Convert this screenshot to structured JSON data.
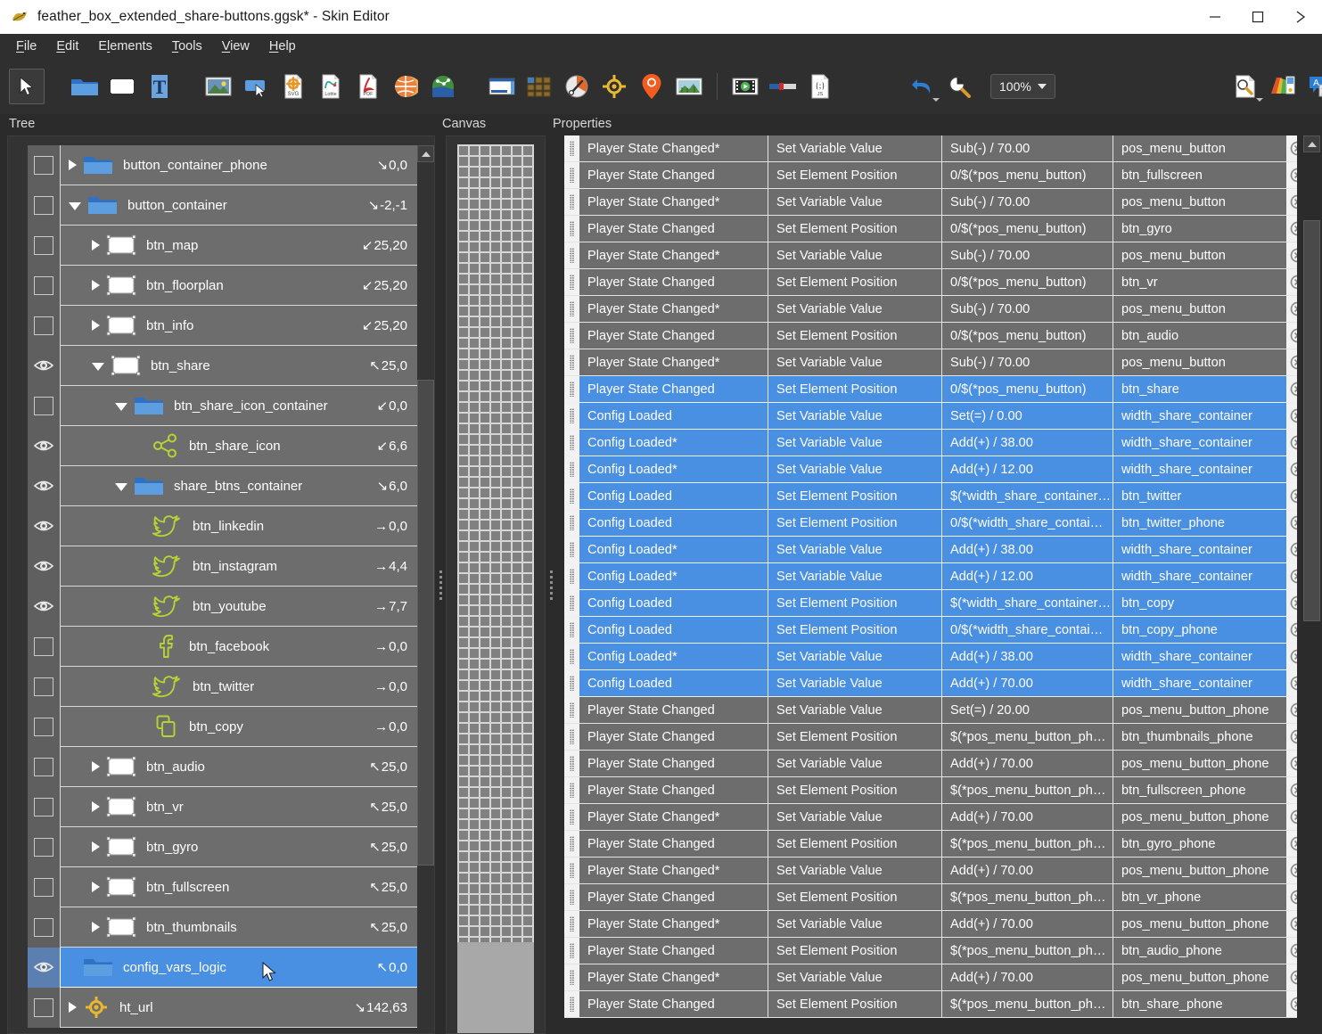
{
  "window": {
    "title": "feather_box_extended_share-buttons.ggsk* - Skin Editor",
    "app_icon": "app-logo-icon",
    "minimize_label": "—",
    "maximize_label": "□",
    "close_label": "✕"
  },
  "menubar": {
    "items": [
      {
        "label": "File",
        "mnemonic": "F"
      },
      {
        "label": "Edit",
        "mnemonic": "E"
      },
      {
        "label": "Elements",
        "mnemonic": "E"
      },
      {
        "label": "Tools",
        "mnemonic": "T"
      },
      {
        "label": "View",
        "mnemonic": "V"
      },
      {
        "label": "Help",
        "mnemonic": "H"
      }
    ]
  },
  "toolbar": {
    "zoom_value": "100%",
    "items": [
      {
        "name": "select-tool-icon",
        "title": "Select"
      },
      {
        "name": "add-container-icon",
        "title": "Container"
      },
      {
        "name": "add-rectangle-icon",
        "title": "Rectangle"
      },
      {
        "name": "add-text-icon",
        "title": "Text"
      },
      {
        "name": "add-image-icon",
        "title": "Image"
      },
      {
        "name": "add-button-icon",
        "title": "Button"
      },
      {
        "name": "add-svg-icon",
        "title": "SVG"
      },
      {
        "name": "add-lottie-icon",
        "title": "Lottie"
      },
      {
        "name": "add-pdf-icon",
        "title": "PDF"
      },
      {
        "name": "add-globe-icon",
        "title": "Globe"
      },
      {
        "name": "add-map-icon",
        "title": "Map"
      },
      {
        "name": "add-iframe-icon",
        "title": "IFrame"
      },
      {
        "name": "add-thumbnails-icon",
        "title": "Thumbnails"
      },
      {
        "name": "add-compass-icon",
        "title": "Compass"
      },
      {
        "name": "add-target-icon",
        "title": "Target"
      },
      {
        "name": "add-mappin-icon",
        "title": "Map pin"
      },
      {
        "name": "add-panorama-icon",
        "title": "Panorama"
      },
      {
        "name": "add-video-icon",
        "title": "Video"
      },
      {
        "name": "add-progressbar-icon",
        "title": "Progress bar"
      },
      {
        "name": "add-javascript-icon",
        "title": "JavaScript"
      },
      {
        "name": "undo-icon",
        "title": "Undo"
      },
      {
        "name": "zoom-tool-icon",
        "title": "Zoom"
      },
      {
        "name": "inspect-document-icon",
        "title": "Inspect"
      },
      {
        "name": "palette-icon",
        "title": "Color palette"
      },
      {
        "name": "translate-icon",
        "title": "Translate"
      },
      {
        "name": "statistics-icon",
        "title": "Statistics"
      }
    ]
  },
  "panels": {
    "tree_header": "Tree",
    "canvas_header": "Canvas",
    "properties_header": "Properties"
  },
  "tree": {
    "rows": [
      {
        "label": "button_container_phone",
        "icon": "folder-icon",
        "indent": 0,
        "twisty": "closed",
        "vis": "checkbox",
        "arrow": "↘",
        "coord": "0,0",
        "selected": false
      },
      {
        "label": "button_container",
        "icon": "folder-icon",
        "indent": 0,
        "twisty": "open",
        "vis": "checkbox",
        "arrow": "↘",
        "coord": "-2,-1",
        "selected": false
      },
      {
        "label": "btn_map",
        "icon": "rect-icon",
        "indent": 1,
        "twisty": "closed",
        "vis": "checkbox",
        "arrow": "↙",
        "coord": "25,20",
        "selected": false
      },
      {
        "label": "btn_floorplan",
        "icon": "rect-icon",
        "indent": 1,
        "twisty": "closed",
        "vis": "checkbox",
        "arrow": "↙",
        "coord": "25,20",
        "selected": false
      },
      {
        "label": "btn_info",
        "icon": "rect-icon",
        "indent": 1,
        "twisty": "closed",
        "vis": "checkbox",
        "arrow": "↙",
        "coord": "25,20",
        "selected": false
      },
      {
        "label": "btn_share",
        "icon": "rect-icon",
        "indent": 1,
        "twisty": "open",
        "vis": "eye",
        "arrow": "↖",
        "coord": "25,0",
        "selected": false
      },
      {
        "label": "btn_share_icon_container",
        "icon": "folder-icon",
        "indent": 2,
        "twisty": "open",
        "vis": "checkbox",
        "arrow": "↙",
        "coord": "0,0",
        "selected": false
      },
      {
        "label": "btn_share_icon",
        "icon": "share-icon",
        "indent": 3,
        "twisty": "none",
        "vis": "eye",
        "arrow": "↙",
        "coord": "6,6",
        "selected": false
      },
      {
        "label": "share_btns_container",
        "icon": "folder-icon",
        "indent": 2,
        "twisty": "open",
        "vis": "eye",
        "arrow": "↘",
        "coord": "6,0",
        "selected": false
      },
      {
        "label": "btn_linkedin",
        "icon": "twitter-icon",
        "indent": 3,
        "twisty": "none",
        "vis": "eye",
        "arrow": "→",
        "coord": "0,0",
        "selected": false
      },
      {
        "label": "btn_instagram",
        "icon": "twitter-icon",
        "indent": 3,
        "twisty": "none",
        "vis": "eye",
        "arrow": "→",
        "coord": "4,4",
        "selected": false
      },
      {
        "label": "btn_youtube",
        "icon": "twitter-icon",
        "indent": 3,
        "twisty": "none",
        "vis": "eye",
        "arrow": "→",
        "coord": "7,7",
        "selected": false
      },
      {
        "label": "btn_facebook",
        "icon": "facebook-icon",
        "indent": 3,
        "twisty": "none",
        "vis": "checkbox",
        "arrow": "→",
        "coord": "0,0",
        "selected": false
      },
      {
        "label": "btn_twitter",
        "icon": "twitter-icon",
        "indent": 3,
        "twisty": "none",
        "vis": "checkbox",
        "arrow": "→",
        "coord": "0,0",
        "selected": false
      },
      {
        "label": "btn_copy",
        "icon": "copy-icon",
        "indent": 3,
        "twisty": "none",
        "vis": "checkbox",
        "arrow": "→",
        "coord": "0,0",
        "selected": false
      },
      {
        "label": "btn_audio",
        "icon": "rect-icon",
        "indent": 1,
        "twisty": "closed",
        "vis": "checkbox",
        "arrow": "↖",
        "coord": "25,0",
        "selected": false
      },
      {
        "label": "btn_vr",
        "icon": "rect-icon",
        "indent": 1,
        "twisty": "closed",
        "vis": "checkbox",
        "arrow": "↖",
        "coord": "25,0",
        "selected": false
      },
      {
        "label": "btn_gyro",
        "icon": "rect-icon",
        "indent": 1,
        "twisty": "closed",
        "vis": "checkbox",
        "arrow": "↖",
        "coord": "25,0",
        "selected": false
      },
      {
        "label": "btn_fullscreen",
        "icon": "rect-icon",
        "indent": 1,
        "twisty": "closed",
        "vis": "checkbox",
        "arrow": "↖",
        "coord": "25,0",
        "selected": false
      },
      {
        "label": "btn_thumbnails",
        "icon": "rect-icon",
        "indent": 1,
        "twisty": "closed",
        "vis": "checkbox",
        "arrow": "↖",
        "coord": "25,0",
        "selected": false
      },
      {
        "label": "config_vars_logic",
        "icon": "folder-icon",
        "indent": 0,
        "twisty": "none",
        "vis": "eye",
        "arrow": "↖",
        "coord": "0,0",
        "selected": true
      },
      {
        "label": "ht_url",
        "icon": "target-icon",
        "indent": 0,
        "twisty": "closed",
        "vis": "checkbox",
        "arrow": "↘",
        "coord": "142,63",
        "selected": false
      }
    ]
  },
  "properties": {
    "columns": [
      "Event",
      "Action",
      "Value",
      "Target"
    ],
    "rows": [
      {
        "event": "Player State Changed*",
        "action": "Set Variable Value",
        "value": "Sub(-) / 70.00",
        "target": "pos_menu_button",
        "selected": false
      },
      {
        "event": "Player State Changed",
        "action": "Set Element Position",
        "value": "0/$(*pos_menu_button)",
        "target": "btn_fullscreen",
        "selected": false
      },
      {
        "event": "Player State Changed*",
        "action": "Set Variable Value",
        "value": "Sub(-) / 70.00",
        "target": "pos_menu_button",
        "selected": false
      },
      {
        "event": "Player State Changed",
        "action": "Set Element Position",
        "value": "0/$(*pos_menu_button)",
        "target": "btn_gyro",
        "selected": false
      },
      {
        "event": "Player State Changed*",
        "action": "Set Variable Value",
        "value": "Sub(-) / 70.00",
        "target": "pos_menu_button",
        "selected": false
      },
      {
        "event": "Player State Changed",
        "action": "Set Element Position",
        "value": "0/$(*pos_menu_button)",
        "target": "btn_vr",
        "selected": false
      },
      {
        "event": "Player State Changed*",
        "action": "Set Variable Value",
        "value": "Sub(-) / 70.00",
        "target": "pos_menu_button",
        "selected": false
      },
      {
        "event": "Player State Changed",
        "action": "Set Element Position",
        "value": "0/$(*pos_menu_button)",
        "target": "btn_audio",
        "selected": false
      },
      {
        "event": "Player State Changed*",
        "action": "Set Variable Value",
        "value": "Sub(-) / 70.00",
        "target": "pos_menu_button",
        "selected": false
      },
      {
        "event": "Player State Changed",
        "action": "Set Element Position",
        "value": "0/$(*pos_menu_button)",
        "target": "btn_share",
        "selected": true
      },
      {
        "event": "Config Loaded",
        "action": "Set Variable Value",
        "value": "Set(=) / 0.00",
        "target": "width_share_container",
        "selected": true
      },
      {
        "event": "Config Loaded*",
        "action": "Set Variable Value",
        "value": "Add(+) / 38.00",
        "target": "width_share_container",
        "selected": true
      },
      {
        "event": "Config Loaded*",
        "action": "Set Variable Value",
        "value": "Add(+) / 12.00",
        "target": "width_share_container",
        "selected": true
      },
      {
        "event": "Config Loaded",
        "action": "Set Element Position",
        "value": "$(*width_share_container…",
        "target": "btn_twitter",
        "selected": true
      },
      {
        "event": "Config Loaded",
        "action": "Set Element Position",
        "value": "0/$(*width_share_contai…",
        "target": "btn_twitter_phone",
        "selected": true
      },
      {
        "event": "Config Loaded*",
        "action": "Set Variable Value",
        "value": "Add(+) / 38.00",
        "target": "width_share_container",
        "selected": true
      },
      {
        "event": "Config Loaded*",
        "action": "Set Variable Value",
        "value": "Add(+) / 12.00",
        "target": "width_share_container",
        "selected": true
      },
      {
        "event": "Config Loaded",
        "action": "Set Element Position",
        "value": "$(*width_share_container…",
        "target": "btn_copy",
        "selected": true
      },
      {
        "event": "Config Loaded",
        "action": "Set Element Position",
        "value": "0/$(*width_share_contai…",
        "target": "btn_copy_phone",
        "selected": true
      },
      {
        "event": "Config Loaded*",
        "action": "Set Variable Value",
        "value": "Add(+) / 38.00",
        "target": "width_share_container",
        "selected": true
      },
      {
        "event": "Config Loaded",
        "action": "Set Variable Value",
        "value": "Add(+) / 70.00",
        "target": "width_share_container",
        "selected": true
      },
      {
        "event": "Player State Changed",
        "action": "Set Variable Value",
        "value": "Set(=) / 20.00",
        "target": "pos_menu_button_phone",
        "selected": false
      },
      {
        "event": "Player State Changed",
        "action": "Set Element Position",
        "value": "$(*pos_menu_button_ph…",
        "target": "btn_thumbnails_phone",
        "selected": false
      },
      {
        "event": "Player State Changed",
        "action": "Set Variable Value",
        "value": "Add(+) / 70.00",
        "target": "pos_menu_button_phone",
        "selected": false
      },
      {
        "event": "Player State Changed",
        "action": "Set Element Position",
        "value": "$(*pos_menu_button_ph…",
        "target": "btn_fullscreen_phone",
        "selected": false
      },
      {
        "event": "Player State Changed*",
        "action": "Set Variable Value",
        "value": "Add(+) / 70.00",
        "target": "pos_menu_button_phone",
        "selected": false
      },
      {
        "event": "Player State Changed",
        "action": "Set Element Position",
        "value": "$(*pos_menu_button_ph…",
        "target": "btn_gyro_phone",
        "selected": false
      },
      {
        "event": "Player State Changed*",
        "action": "Set Variable Value",
        "value": "Add(+) / 70.00",
        "target": "pos_menu_button_phone",
        "selected": false
      },
      {
        "event": "Player State Changed",
        "action": "Set Element Position",
        "value": "$(*pos_menu_button_ph…",
        "target": "btn_vr_phone",
        "selected": false
      },
      {
        "event": "Player State Changed*",
        "action": "Set Variable Value",
        "value": "Add(+) / 70.00",
        "target": "pos_menu_button_phone",
        "selected": false
      },
      {
        "event": "Player State Changed",
        "action": "Set Element Position",
        "value": "$(*pos_menu_button_ph…",
        "target": "btn_audio_phone",
        "selected": false
      },
      {
        "event": "Player State Changed*",
        "action": "Set Variable Value",
        "value": "Add(+) / 70.00",
        "target": "pos_menu_button_phone",
        "selected": false
      },
      {
        "event": "Player State Changed",
        "action": "Set Element Position",
        "value": "$(*pos_menu_button_ph…",
        "target": "btn_share_phone",
        "selected": false
      }
    ]
  },
  "colors": {
    "accent_selection": "#4a90e2",
    "row_bg": "#6d6d6d",
    "panel_bg": "#333333",
    "chrome_bg": "#2f2f2f",
    "icon_green": "#b5d334",
    "folder_blue": "#4a90e2"
  }
}
